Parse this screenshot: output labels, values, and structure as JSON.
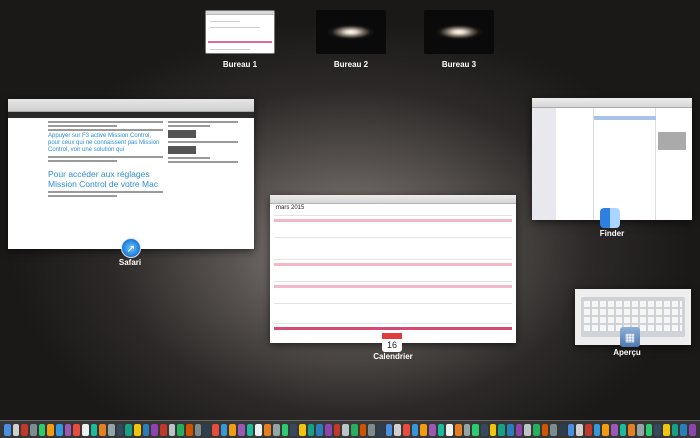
{
  "spaces": [
    {
      "label": "Bureau 1"
    },
    {
      "label": "Bureau 2"
    },
    {
      "label": "Bureau 3"
    }
  ],
  "windows": {
    "safari": {
      "app_label": "Safari",
      "heading_small": "Appuyer sur F3 active Mission Control, pour ceux qui ne connaissent pas Mission Control, voir une solution qui",
      "heading_big": "Pour accéder aux réglages Mission Control de votre Mac"
    },
    "finder": {
      "app_label": "Finder"
    },
    "calendar": {
      "app_label": "Calendrier",
      "month": "mars 2015",
      "icon_day": "16"
    },
    "apercu": {
      "app_label": "Aperçu"
    }
  },
  "icons": {
    "safari": "compass-icon",
    "finder": "finder-face-icon",
    "calendar": "calendar-icon",
    "apercu": "preview-icon"
  },
  "dock": {
    "colors": [
      "#4a90e2",
      "#d0d0d0",
      "#c0392b",
      "#7f8c8d",
      "#2ecc71",
      "#f39c12",
      "#3498db",
      "#9b59b6",
      "#e74c3c",
      "#ecf0f1",
      "#1abc9c",
      "#e67e22",
      "#95a5a6",
      "#34495e",
      "#16a085",
      "#f1c40f",
      "#2980b9",
      "#8e44ad",
      "#c0392b",
      "#bdc3c7",
      "#27ae60",
      "#d35400",
      "#7f8c8d",
      "#2c3e50",
      "#e74c3c",
      "#3498db",
      "#f39c12",
      "#9b59b6",
      "#1abc9c",
      "#ecf0f1",
      "#e67e22",
      "#95a5a6",
      "#2ecc71",
      "#34495e",
      "#f1c40f",
      "#16a085",
      "#2980b9",
      "#8e44ad",
      "#c0392b",
      "#bdc3c7",
      "#27ae60",
      "#d35400",
      "#7f8c8d",
      "#2c3e50",
      "#4a90e2",
      "#d0d0d0",
      "#e74c3c",
      "#3498db",
      "#f39c12",
      "#9b59b6",
      "#1abc9c",
      "#ecf0f1",
      "#e67e22",
      "#95a5a6",
      "#2ecc71",
      "#34495e",
      "#f1c40f",
      "#16a085",
      "#2980b9",
      "#8e44ad",
      "#bdc3c7",
      "#27ae60",
      "#d35400",
      "#7f8c8d",
      "#2c3e50",
      "#4a90e2",
      "#d0d0d0",
      "#c0392b",
      "#3498db",
      "#f39c12",
      "#9b59b6",
      "#1abc9c",
      "#e67e22",
      "#95a5a6",
      "#2ecc71",
      "#34495e",
      "#f1c40f",
      "#16a085",
      "#2980b9",
      "#8e44ad"
    ]
  }
}
